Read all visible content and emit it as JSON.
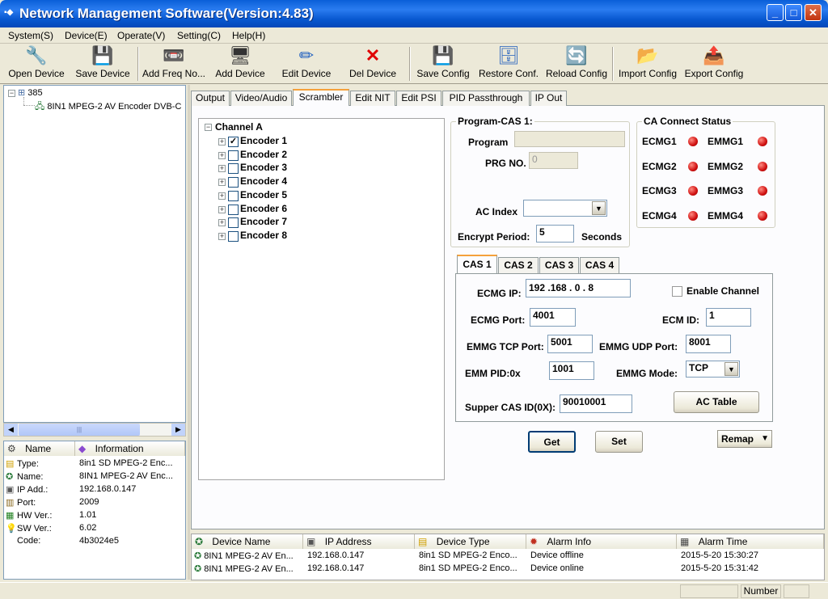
{
  "window": {
    "title": "Network Management Software(Version:4.83)",
    "min": "_",
    "max": "□",
    "close": "✕"
  },
  "menu": [
    "System(S)",
    "Device(E)",
    "Operate(V)",
    "Setting(C)",
    "Help(H)"
  ],
  "toolbar": [
    {
      "label": "Open Device",
      "icon": "open-device-icon",
      "glyph": "🔧"
    },
    {
      "label": "Save Device",
      "icon": "save-device-icon",
      "glyph": "💾"
    },
    {
      "label": "Add Freq No...",
      "icon": "add-freq-icon",
      "glyph": "📼"
    },
    {
      "label": "Add Device",
      "icon": "add-device-icon",
      "glyph": "🖥"
    },
    {
      "label": "Edit Device",
      "icon": "edit-device-icon",
      "glyph": "✏"
    },
    {
      "label": "Del Device",
      "icon": "delete-icon",
      "glyph": "✕"
    },
    {
      "label": "Save Config",
      "icon": "save-config-icon",
      "glyph": "💾"
    },
    {
      "label": "Restore Conf.",
      "icon": "restore-config-icon",
      "glyph": "🗄"
    },
    {
      "label": "Reload Config",
      "icon": "reload-config-icon",
      "glyph": "🔄"
    },
    {
      "label": "Import Config",
      "icon": "import-config-icon",
      "glyph": "📂"
    },
    {
      "label": "Export Config",
      "icon": "export-config-icon",
      "glyph": "📤"
    }
  ],
  "tree": {
    "root": "385",
    "child": "8IN1 MPEG-2 AV Encoder DVB-C"
  },
  "info": {
    "headers": [
      "Name",
      "Information"
    ],
    "rows": [
      {
        "name": "Type:",
        "value": "8in1 SD MPEG-2 Enc..."
      },
      {
        "name": "Name:",
        "value": "8IN1 MPEG-2 AV Enc..."
      },
      {
        "name": "IP Add.:",
        "value": "192.168.0.147"
      },
      {
        "name": "Port:",
        "value": "2009"
      },
      {
        "name": "HW Ver.:",
        "value": "1.01"
      },
      {
        "name": "SW Ver.:",
        "value": "6.02"
      },
      {
        "name": "Code:",
        "value": "4b3024e5"
      }
    ]
  },
  "tabs": [
    "Output",
    "Video/Audio",
    "Scrambler",
    "Edit NIT",
    "Edit PSI",
    "PID Passthrough",
    "IP Out"
  ],
  "channel": {
    "title": "Channel A",
    "encoders": [
      "Encoder 1",
      "Encoder 2",
      "Encoder 3",
      "Encoder 4",
      "Encoder 5",
      "Encoder 6",
      "Encoder 7",
      "Encoder 8"
    ],
    "checked": [
      true,
      false,
      false,
      false,
      false,
      false,
      false,
      false
    ]
  },
  "program_cas": {
    "title": "Program-CAS 1:",
    "program_label": "Program",
    "program_value": "",
    "prgno_label": "PRG NO.",
    "prgno_value": "0",
    "ac_index_label": "AC Index",
    "ac_index_value": "",
    "encrypt_label": "Encrypt Period:",
    "encrypt_value": "5",
    "seconds": "Seconds"
  },
  "ca_status": {
    "title": "CA Connect Status",
    "items": [
      "ECMG1",
      "EMMG1",
      "ECMG2",
      "EMMG2",
      "ECMG3",
      "EMMG3",
      "ECMG4",
      "EMMG4"
    ],
    "led_color": "#d01010"
  },
  "cas_tabs": [
    "CAS 1",
    "CAS 2",
    "CAS 3",
    "CAS 4"
  ],
  "cas": {
    "ecmg_ip_label": "ECMG IP:",
    "ecmg_ip": "192 .168 .  0  .  8",
    "enable_label": "Enable Channel",
    "ecmg_port_label": "ECMG Port:",
    "ecmg_port": "4001",
    "ecm_id_label": "ECM ID:",
    "ecm_id": "1",
    "emmg_tcp_label": "EMMG TCP Port:",
    "emmg_tcp": "5001",
    "emmg_udp_label": "EMMG UDP Port:",
    "emmg_udp": "8001",
    "emm_pid_label": "EMM PID:0x",
    "emm_pid": "1001",
    "emmg_mode_label": "EMMG Mode:",
    "emmg_mode": "TCP",
    "supper_label": "Supper CAS ID(0X):",
    "supper": "90010001",
    "ac_table": "AC Table"
  },
  "buttons": {
    "get": "Get",
    "set": "Set",
    "remap": "Remap"
  },
  "alarm": {
    "headers": [
      "Device Name",
      "IP Address",
      "Device Type",
      "Alarm Info",
      "Alarm Time"
    ],
    "rows": [
      [
        "8IN1 MPEG-2 AV En...",
        "192.168.0.147",
        "8in1 SD MPEG-2 Enco...",
        "Device offline",
        "2015-5-20 15:30:27"
      ],
      [
        "8IN1 MPEG-2 AV En...",
        "192.168.0.147",
        "8in1 SD MPEG-2 Enco...",
        "Device online",
        "2015-5-20 15:31:42"
      ]
    ]
  },
  "status": {
    "number": "Number"
  }
}
